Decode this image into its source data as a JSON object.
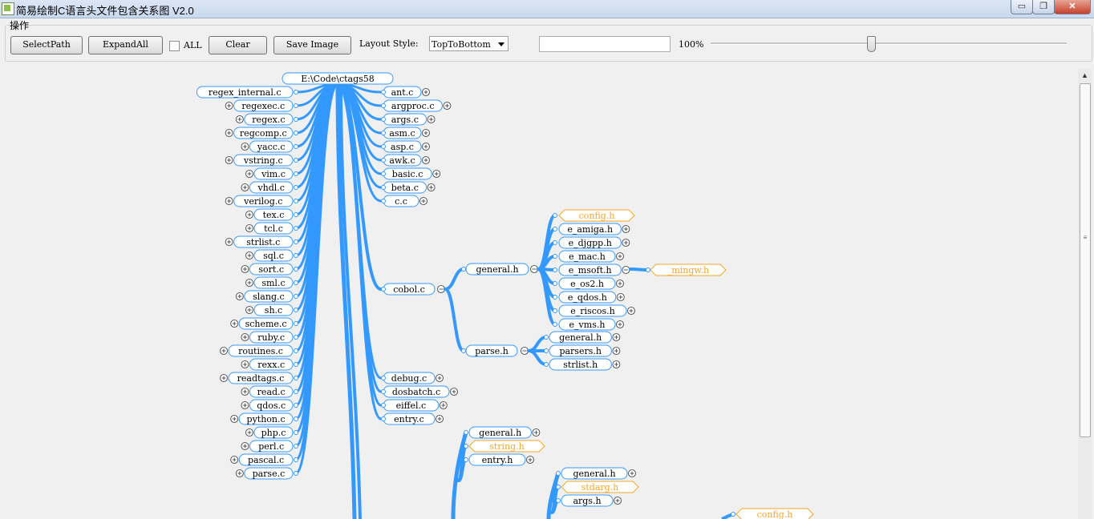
{
  "window": {
    "title": "简易绘制C语言头文件包含关系图 V2.0",
    "min_label": "▭",
    "max_label": "❐",
    "close_label": "✕"
  },
  "toolbar": {
    "group_label": "操作",
    "select_path_label": "SelectPath",
    "expand_all_label": "ExpandAll",
    "all_label": "ALL",
    "clear_label": "Clear",
    "save_image_label": "Save Image",
    "layout_style_label": "Layout Style:",
    "layout_style_value": "TopToBottom",
    "path_input_value": "",
    "zoom_label": "100%",
    "zoom_level_percent": 45
  },
  "graph": {
    "root": "E:\\Code\\ctags58",
    "left_files": [
      "regex_internal.c",
      "regexec.c",
      "regex.c",
      "regcomp.c",
      "yacc.c",
      "vstring.c",
      "vim.c",
      "vhdl.c",
      "verilog.c",
      "tex.c",
      "tcl.c",
      "strlist.c",
      "sql.c",
      "sort.c",
      "sml.c",
      "slang.c",
      "sh.c",
      "scheme.c",
      "ruby.c",
      "routines.c",
      "rexx.c",
      "readtags.c",
      "read.c",
      "qdos.c",
      "python.c",
      "php.c",
      "perl.c",
      "pascal.c",
      "parse.c"
    ],
    "right_files_top": [
      "ant.c",
      "argproc.c",
      "args.c",
      "asm.c",
      "asp.c",
      "awk.c",
      "basic.c",
      "beta.c",
      "c.c"
    ],
    "cobol": "cobol.c",
    "cobol_children": [
      "general.h",
      "parse.h"
    ],
    "general_children": [
      "config.h",
      "e_amiga.h",
      "e_djgpp.h",
      "e_mac.h",
      "e_msoft.h",
      "e_os2.h",
      "e_qdos.h",
      "e_riscos.h",
      "e_vms.h"
    ],
    "msoft_child": "_mingw.h",
    "parse_children": [
      "general.h",
      "parsers.h",
      "strlist.h"
    ],
    "right_files_mid": [
      "debug.c",
      "dosbatch.c",
      "eiffel.c",
      "entry.c"
    ],
    "entry_children": [
      "general.h",
      "string.h",
      "entry.h"
    ],
    "lower_children": [
      "general.h",
      "stdarg.h",
      "args.h"
    ],
    "bottom_config": "config.h",
    "colors": {
      "edge": "#3399ff",
      "node_border": "#3399ff",
      "system_header": "#f5a623",
      "system_header_text": "#f5a623"
    }
  }
}
